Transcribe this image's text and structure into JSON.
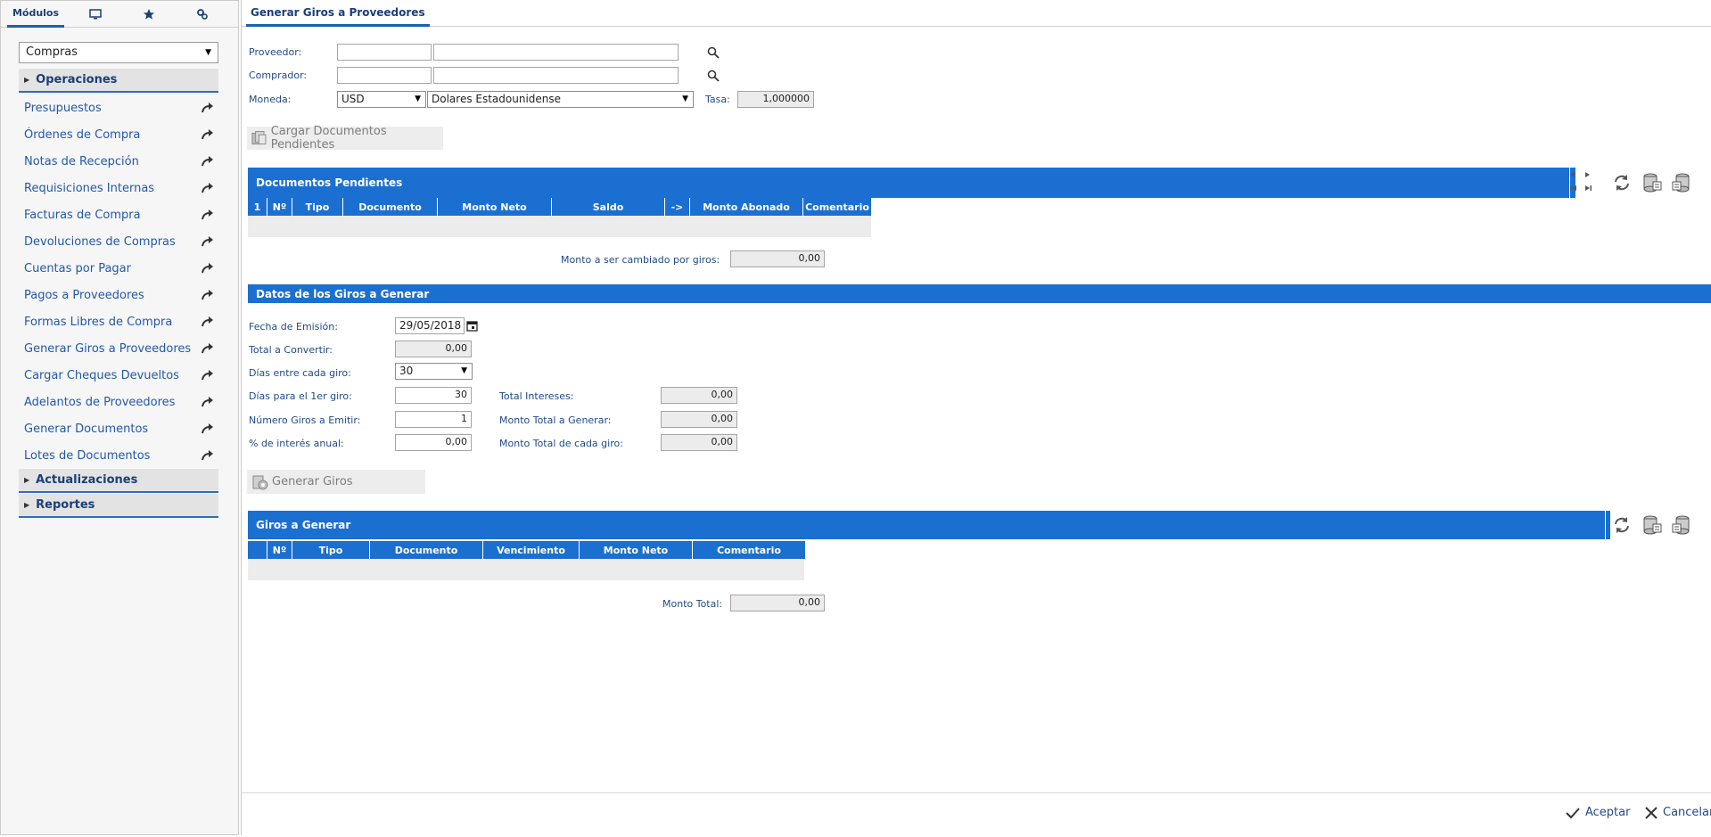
{
  "left_tabs": {
    "modules": "Módulos"
  },
  "module_select": {
    "value": "Compras"
  },
  "sections": {
    "operaciones": "Operaciones",
    "actualizaciones": "Actualizaciones",
    "reportes": "Reportes"
  },
  "nav_items": [
    "Presupuestos",
    "Órdenes de Compra",
    "Notas de Recepción",
    "Requisiciones Internas",
    "Facturas de Compra",
    "Devoluciones de Compras",
    "Cuentas por Pagar",
    "Pagos a Proveedores",
    "Formas Libres de Compra",
    "Generar Giros a Proveedores",
    "Cargar Cheques Devueltos",
    "Adelantos de Proveedores",
    "Generar Documentos",
    "Lotes de Documentos"
  ],
  "main_tab": "Generar Giros a Proveedores",
  "form": {
    "proveedor_label": "Proveedor:",
    "comprador_label": "Comprador:",
    "moneda_label": "Moneda:",
    "moneda_code": "USD",
    "moneda_name": "Dolares Estadounidense",
    "tasa_label": "Tasa:",
    "tasa_value": "1,000000"
  },
  "cargar_button": "Cargar Documentos Pendientes",
  "pendientes": {
    "title": "Documentos Pendientes",
    "columns": [
      "1",
      "Nº",
      "Tipo",
      "Documento",
      "Monto Neto",
      "Saldo",
      "->",
      "Monto Abonado",
      "Comentario"
    ],
    "monto_label": "Monto a ser cambiado por giros:",
    "monto_value": "0,00"
  },
  "datos": {
    "title": "Datos de los Giros a Generar",
    "fecha_label": "Fecha de Emisión:",
    "fecha_value": "29/05/2018",
    "total_convertir_label": "Total a Convertir:",
    "total_convertir_value": "0,00",
    "dias_entre_label": "Días entre cada giro:",
    "dias_entre_value": "30",
    "dias_primer_label": "Días para el 1er giro:",
    "dias_primer_value": "30",
    "numero_giros_label": "Número Giros a Emitir:",
    "numero_giros_value": "1",
    "interes_label": "% de interés anual:",
    "interes_value": "0,00",
    "total_intereses_label": "Total Intereses:",
    "total_intereses_value": "0,00",
    "monto_total_generar_label": "Monto Total a Generar:",
    "monto_total_generar_value": "0,00",
    "monto_cada_label": "Monto Total de cada giro:",
    "monto_cada_value": "0,00"
  },
  "generar_button": "Generar Giros",
  "giros": {
    "title": "Giros a Generar",
    "columns": [
      "",
      "Nº",
      "Tipo",
      "Documento",
      "Vencimiento",
      "Monto Neto",
      "Comentario"
    ],
    "monto_total_label": "Monto Total:",
    "monto_total_value": "0,00"
  },
  "footer": {
    "accept": "Aceptar",
    "cancel": "Cancelar"
  },
  "colors": {
    "accent": "#1b6fd1",
    "nav_text": "#2458a6"
  }
}
